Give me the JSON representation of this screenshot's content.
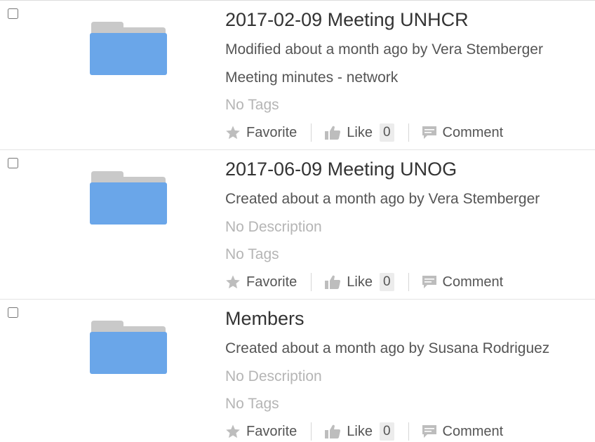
{
  "colors": {
    "folder_body": "#6aa6e9",
    "folder_tab": "#c9c9c9",
    "muted_text": "#b5b5b5",
    "icon_gray": "#bdbdbd"
  },
  "icons": {
    "folder": "folder-icon",
    "favorite": "star-icon",
    "like": "thumbs-up-icon",
    "comment": "comment-icon"
  },
  "items": [
    {
      "title": "2017-02-09 Meeting UNHCR",
      "meta": "Modified about a month ago by Vera Stemberger",
      "description": "Meeting minutes - network",
      "tags": "No Tags",
      "favorite_label": "Favorite",
      "like_label": "Like",
      "like_count": "0",
      "comment_label": "Comment"
    },
    {
      "title": "2017-06-09 Meeting UNOG",
      "meta": "Created about a month ago by Vera Stemberger",
      "description": "No Description",
      "tags": "No Tags",
      "favorite_label": "Favorite",
      "like_label": "Like",
      "like_count": "0",
      "comment_label": "Comment"
    },
    {
      "title": "Members",
      "meta": "Created about a month ago by Susana Rodriguez",
      "description": "No Description",
      "tags": "No Tags",
      "favorite_label": "Favorite",
      "like_label": "Like",
      "like_count": "0",
      "comment_label": "Comment"
    }
  ]
}
